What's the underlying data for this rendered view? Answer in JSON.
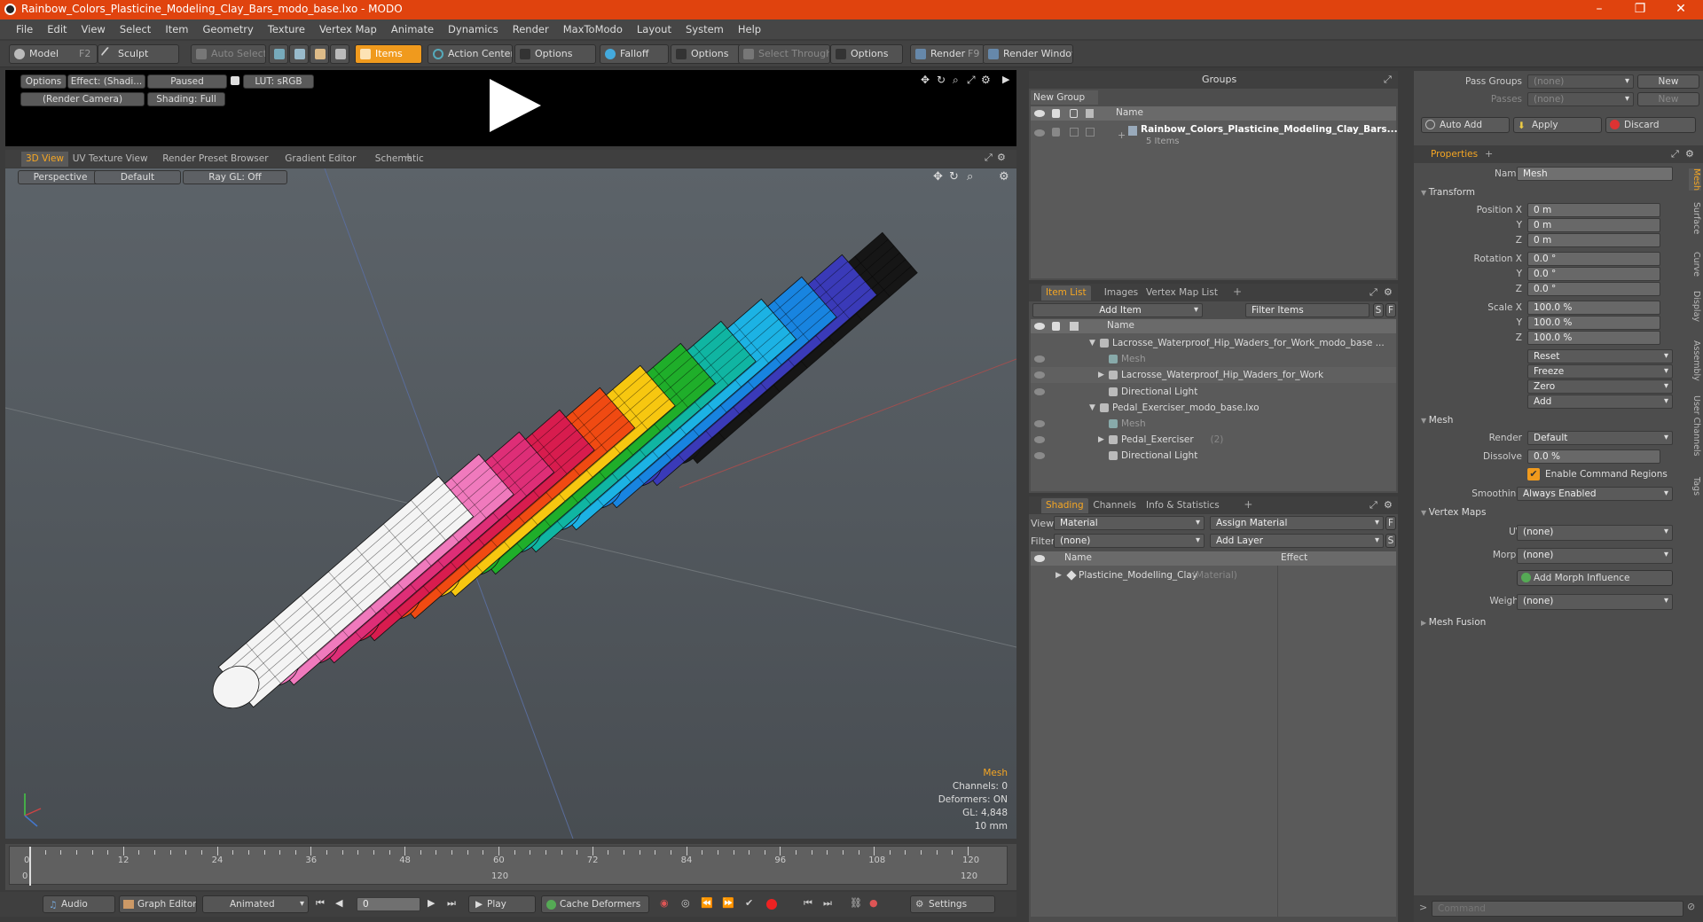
{
  "window": {
    "title": "Rainbow_Colors_Plasticine_Modeling_Clay_Bars_modo_base.lxo - MODO"
  },
  "menu": [
    "File",
    "Edit",
    "View",
    "Select",
    "Item",
    "Geometry",
    "Texture",
    "Vertex Map",
    "Animate",
    "Dynamics",
    "Render",
    "MaxToModo",
    "Layout",
    "System",
    "Help"
  ],
  "toolbar": {
    "model": "Model",
    "model_key": "F2",
    "sculpt": "Sculpt",
    "auto_select": "Auto Select",
    "items": "Items",
    "action_center": "Action Center",
    "options1": "Options",
    "falloff": "Falloff",
    "options2": "Options",
    "select_through": "Select Through",
    "options3": "Options",
    "render": "Render",
    "render_key": "F9",
    "render_window": "Render Window"
  },
  "preview": {
    "options": "Options",
    "effect": "Effect: (Shadi...",
    "paused": "Paused",
    "lut": "LUT: sRGB",
    "camera": "(Render Camera)",
    "shading": "Shading: Full"
  },
  "viewport_tabs": [
    "3D View",
    "UV Texture View",
    "Render Preset Browser",
    "Gradient Editor",
    "Schematic"
  ],
  "viewport": {
    "perspective": "Perspective",
    "default": "Default",
    "raygl": "Ray GL: Off",
    "info": {
      "mesh": "Mesh",
      "channels": "Channels: 0",
      "deformers": "Deformers: ON",
      "gl": "GL: 4,848",
      "unit": "10 mm"
    }
  },
  "bar_colors": [
    "#f4f4f4",
    "#f07abd",
    "#de2e77",
    "#d81c4e",
    "#f04a12",
    "#f7c710",
    "#1fae2a",
    "#10b5a2",
    "#1cb2e4",
    "#1884e0",
    "#3a3ab8",
    "#161616"
  ],
  "timeline": {
    "ticks": [
      "0",
      "12",
      "24",
      "36",
      "48",
      "60",
      "72",
      "84",
      "96",
      "108",
      "120"
    ],
    "bottom_ticks": [
      "0",
      "120",
      "120"
    ]
  },
  "transport": {
    "audio": "Audio",
    "graph_editor": "Graph Editor",
    "animated": "Animated",
    "frame": "0",
    "play": "Play",
    "cache": "Cache Deformers",
    "settings": "Settings"
  },
  "groups": {
    "title": "Groups",
    "new_group": "New Group",
    "col_name": "Name",
    "item_name": "Rainbow_Colors_Plasticine_Modeling_Clay_Bars...",
    "item_count": "5 Items"
  },
  "itemlist": {
    "tabs": [
      "Item List",
      "Images",
      "Vertex Map List"
    ],
    "add_item": "Add Item",
    "filter": "Filter Items",
    "col_name": "Name",
    "rows": [
      {
        "label": "Lacrosse_Waterproof_Hip_Waders_for_Work_modo_base ...",
        "indent": 0,
        "arrow": "▼",
        "eye": false,
        "dim": false
      },
      {
        "label": "Mesh",
        "indent": 1,
        "arrow": "",
        "eye": true,
        "dim": true
      },
      {
        "label": "Lacrosse_Waterproof_Hip_Waders_for_Work",
        "indent": 1,
        "arrow": "▶",
        "eye": true,
        "dim": false
      },
      {
        "label": "Directional Light",
        "indent": 1,
        "arrow": "",
        "eye": true,
        "dim": false
      },
      {
        "label": "Pedal_Exerciser_modo_base.lxo",
        "indent": 0,
        "arrow": "▼",
        "eye": false,
        "dim": false
      },
      {
        "label": "Mesh",
        "indent": 1,
        "arrow": "",
        "eye": true,
        "dim": true
      },
      {
        "label": "Pedal_Exerciser",
        "indent": 1,
        "arrow": "▶",
        "eye": true,
        "dim": false,
        "suffix": "(2)"
      },
      {
        "label": "Directional Light",
        "indent": 1,
        "arrow": "",
        "eye": true,
        "dim": false
      }
    ]
  },
  "shading": {
    "tabs": [
      "Shading",
      "Channels",
      "Info & Statistics"
    ],
    "view_label": "View",
    "view_value": "Material",
    "assign": "Assign Material",
    "filter_label": "Filter",
    "filter_value": "(none)",
    "add_layer": "Add Layer",
    "col_name": "Name",
    "col_effect": "Effect",
    "row": "Plasticine_Modelling_Clay",
    "row_type": "(Material)"
  },
  "passes": {
    "groups_label": "Pass Groups",
    "groups_value": "(none)",
    "new1": "New",
    "passes_label": "Passes",
    "passes_value": "(none)",
    "new2": "New",
    "auto_add": "Auto Add",
    "apply": "Apply",
    "discard": "Discard"
  },
  "properties": {
    "tab": "Properties",
    "name_label": "Name",
    "name_value": "Mesh",
    "transform": "Transform",
    "position_label": "Position X",
    "pos": [
      "0 m",
      "0 m",
      "0 m"
    ],
    "rotation_label": "Rotation X",
    "rot": [
      "0.0 °",
      "0.0 °",
      "0.0 °"
    ],
    "scale_label": "Scale X",
    "scl": [
      "100.0 %",
      "100.0 %",
      "100.0 %"
    ],
    "y": "Y",
    "z": "Z",
    "reset": "Reset",
    "freeze": "Freeze",
    "zero": "Zero",
    "add": "Add",
    "mesh": "Mesh",
    "render_label": "Render",
    "render_value": "Default",
    "dissolve_label": "Dissolve",
    "dissolve_value": "0.0 %",
    "enable_cmd": "Enable Command Regions",
    "smoothing_label": "Smoothing",
    "smoothing_value": "Always Enabled",
    "vertex_maps": "Vertex Maps",
    "uv_label": "UV",
    "uv_value": "(none)",
    "morph_label": "Morph",
    "morph_value": "(none)",
    "add_morph": "Add Morph Influence",
    "weight_label": "Weight",
    "weight_value": "(none)",
    "mesh_fusion": "Mesh Fusion",
    "side_tabs": [
      "Mesh",
      "Surface",
      "Curve",
      "Display",
      "Assembly",
      "User Channels",
      "Tags"
    ]
  },
  "command": {
    "placeholder": "Command"
  }
}
